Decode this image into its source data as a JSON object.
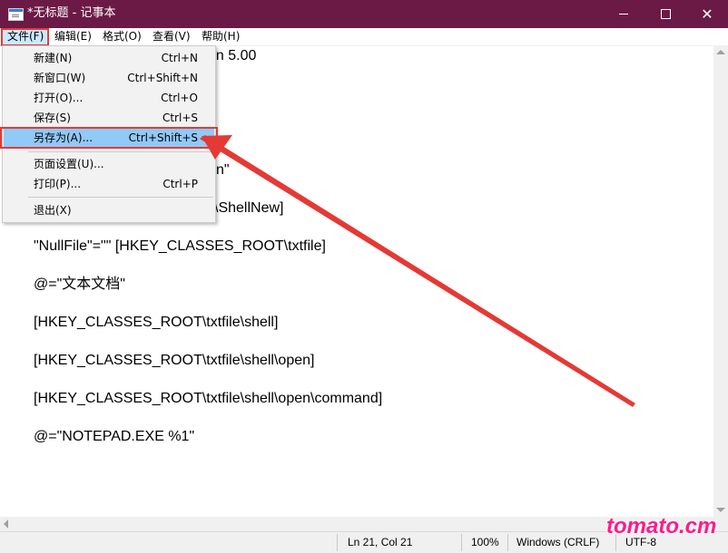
{
  "window": {
    "title": "*无标题 - 记事本",
    "controls": {
      "minimize": "minimize",
      "maximize": "maximize",
      "close": "close"
    }
  },
  "menubar": {
    "file": "文件(F)",
    "edit": "编辑(E)",
    "format": "格式(O)",
    "view": "查看(V)",
    "help": "帮助(H)"
  },
  "file_menu": {
    "items": [
      {
        "label": "新建(N)",
        "shortcut": "Ctrl+N"
      },
      {
        "label": "新窗口(W)",
        "shortcut": "Ctrl+Shift+N"
      },
      {
        "label": "打开(O)...",
        "shortcut": "Ctrl+O"
      },
      {
        "label": "保存(S)",
        "shortcut": "Ctrl+S"
      },
      {
        "label": "另存为(A)...",
        "shortcut": "Ctrl+Shift+S",
        "highlighted": true
      },
      {
        "label": "页面设置(U)...",
        "shortcut": ""
      },
      {
        "label": "打印(P)...",
        "shortcut": "Ctrl+P"
      },
      {
        "label": "退出(X)",
        "shortcut": ""
      }
    ]
  },
  "editor": {
    "visible_lines": [
      "on 5.00",
      "]",
      "n\"",
      "\\ShellNew]",
      "\"NullFile\"=\"\" [HKEY_CLASSES_ROOT\\txtfile]",
      "@=\"文本文档\"",
      "[HKEY_CLASSES_ROOT\\txtfile\\shell]",
      "[HKEY_CLASSES_ROOT\\txtfile\\shell\\open]",
      "[HKEY_CLASSES_ROOT\\txtfile\\shell\\open\\command]",
      "@=\"NOTEPAD.EXE %1\""
    ]
  },
  "statusbar": {
    "position": "Ln 21, Col 21",
    "zoom": "100%",
    "line_ending": "Windows (CRLF)",
    "encoding": "UTF-8"
  },
  "watermark": "tomato.cm",
  "colors": {
    "titlebar": "#6b1a45",
    "annotation_red": "#e53935",
    "menu_highlight": "#91c9f7",
    "watermark": "#ff1a8c"
  }
}
